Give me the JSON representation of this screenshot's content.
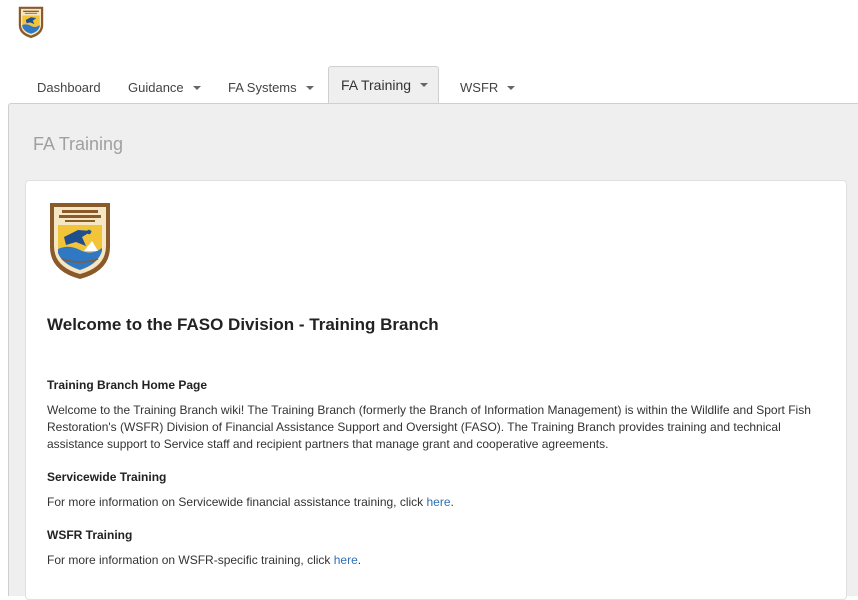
{
  "nav": {
    "tabs": [
      {
        "label": "Dashboard"
      },
      {
        "label": "Guidance"
      },
      {
        "label": "FA Systems"
      },
      {
        "label": "FA Training"
      },
      {
        "label": "WSFR"
      }
    ]
  },
  "panel": {
    "title": "FA Training"
  },
  "content": {
    "welcome_heading": "Welcome to the FASO Division - Training Branch",
    "sections": [
      {
        "heading": "Training Branch Home Page",
        "text": "Welcome to the Training Branch wiki! The Training Branch (formerly the Branch of Information Management) is within the Wildlife and Sport Fish Restoration's (WSFR) Division of Financial Assistance Support and Oversight (FASO). The Training Branch provides training and technical assistance support to Service staff and recipient partners that manage grant and cooperative agreements."
      },
      {
        "heading": "Servicewide Training",
        "text": "For more information on Servicewide financial assistance training, click ",
        "link": "here",
        "tail": "."
      },
      {
        "heading": "WSFR Training",
        "text": "For more information on WSFR-specific training, click ",
        "link": "here",
        "tail": "."
      }
    ]
  },
  "colors": {
    "link": "#2f6fb0",
    "panel_bg": "#efefef",
    "logo_brown": "#8b5a2b",
    "logo_yellow": "#f2c43a",
    "logo_blue": "#2f78c4"
  },
  "icons": {
    "top_logo": "usfws-emblem-icon",
    "card_logo": "usfws-emblem-icon",
    "dropdown": "caret-down-icon"
  }
}
